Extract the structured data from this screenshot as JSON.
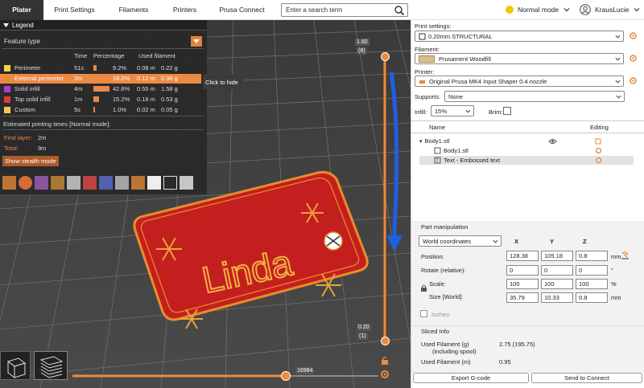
{
  "tabs": [
    {
      "label": "Plater",
      "active": true
    },
    {
      "label": "Print Settings"
    },
    {
      "label": "Filaments"
    },
    {
      "label": "Printers"
    },
    {
      "label": "Prusa Connect"
    }
  ],
  "search": {
    "placeholder": "Enter a search term"
  },
  "mode": {
    "label": "Normal mode",
    "color": "#f3c800"
  },
  "user": {
    "name": "KrausLucie"
  },
  "legend": {
    "title": "Legend",
    "feature_type": "Feature type",
    "columns": [
      "Time",
      "Percentage",
      "Used filament"
    ],
    "rows": [
      {
        "name": "Perimeter",
        "time": "51s",
        "pct": "9.2%",
        "pct_value": 9.2,
        "m": "0.08 m",
        "g": "0.22 g",
        "color": "#f5d14a"
      },
      {
        "name": "External perimeter",
        "time": "2m",
        "pct": "18.0%",
        "pct_value": 18.0,
        "m": "0.12 m",
        "g": "0.36 g",
        "color": "#e58c33",
        "selected": true
      },
      {
        "name": "Solid infill",
        "time": "4m",
        "pct": "42.8%",
        "pct_value": 42.8,
        "m": "0.55 m",
        "g": "1.58 g",
        "color": "#b43cc8"
      },
      {
        "name": "Top solid infill",
        "time": "1m",
        "pct": "15.2%",
        "pct_value": 15.2,
        "m": "0.18 m",
        "g": "0.53 g",
        "color": "#e33a3a"
      },
      {
        "name": "Custom",
        "time": "5s",
        "pct": "1.0%",
        "pct_value": 1.0,
        "m": "0.02 m",
        "g": "0.05 g",
        "color": "#f2c65a"
      }
    ],
    "estimated": "Estimated printing times [Normal mode]:",
    "first_layer_label": "First layer:",
    "first_layer_value": "2m",
    "total_label": "Total:",
    "total_value": "9m",
    "stealth_button": "Show stealth mode"
  },
  "tooltip": "Click to hide",
  "vslider": {
    "top_value": "1.60",
    "top_layer": "(8)",
    "bottom_value": "0.20",
    "bottom_layer": "(1)"
  },
  "hslider": {
    "value": "16984"
  },
  "model_text": "Linda",
  "panel": {
    "print_settings_label": "Print settings:",
    "print_settings_value": "0.20mm STRUCTURAL",
    "filament_label": "Filament:",
    "filament_value": "Prusament Woodfill",
    "filament_color": "#d9bf8a",
    "printer_label": "Printer:",
    "printer_value": "Original Prusa MK4 Input Shaper 0.4 nozzle",
    "supports_label": "Supports:",
    "supports_value": "None",
    "infill_label": "Infill:",
    "infill_value": "15%",
    "brim_label": "Brim:",
    "objects_header_name": "Name",
    "objects_header_editing": "Editing",
    "objects": [
      {
        "name": "Body1.stl",
        "level": 0
      },
      {
        "name": "Body1.stl",
        "level": 1
      },
      {
        "name": "Text - Embossed text",
        "level": 1,
        "selected": true
      }
    ],
    "part_manipulation": "Part manipulation",
    "coords_value": "World coordinates",
    "axis_x": "X",
    "axis_y": "Y",
    "axis_z": "Z",
    "position_label": "Position:",
    "position": [
      "128.38",
      "105.18",
      "0.8"
    ],
    "position_unit": "mm",
    "rotate_label": "Rotate (relative):",
    "rotate": [
      "0",
      "0",
      "0"
    ],
    "rotate_unit": "°",
    "scale_label": "Scale:",
    "scale": [
      "100",
      "100",
      "100"
    ],
    "scale_unit": "%",
    "size_label": "Size [World]:",
    "size": [
      "35.79",
      "10.33",
      "0.8"
    ],
    "size_unit": "mm",
    "inches_label": "Inches",
    "sliced_info": "Sliced Info",
    "used_g_label": "Used Filament (g)",
    "used_g_sub": "(including spool)",
    "used_g_value": "2.75 (195.75)",
    "used_m_label": "Used Filament (m)",
    "used_m_value": "0.95",
    "export_button": "Export G-code",
    "send_button": "Send to Connect"
  }
}
